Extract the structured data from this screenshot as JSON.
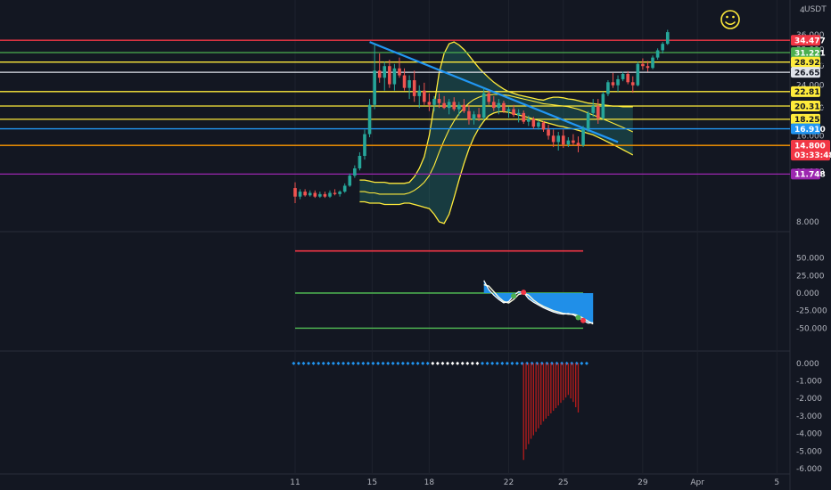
{
  "header": {
    "currency": "USDT",
    "corner_mark": "4"
  },
  "chart_data": [
    {
      "type": "candlestick",
      "panel": "price",
      "y_scale": "log",
      "ylim": [
        7.5,
        39
      ],
      "y_ticks": [
        "36.000",
        "32.000",
        "28.000",
        "24.000",
        "20.000",
        "16.000",
        "12.000",
        "8.000"
      ],
      "x_ticks": [
        "11",
        "15",
        "18",
        "22",
        "25",
        "29",
        "Apr",
        "5"
      ],
      "price_levels": [
        {
          "value": 34.477,
          "label": "34.477",
          "color": "#f23645"
        },
        {
          "value": 31.221,
          "label": "31.221",
          "color": "#4caf50"
        },
        {
          "value": 28.922,
          "label": "28.922",
          "color": "#ffeb3b"
        },
        {
          "value": 26.656,
          "label": "26.656",
          "color": "#e0e3eb"
        },
        {
          "value": 22.811,
          "label": "22.811",
          "color": "#ffeb3b"
        },
        {
          "value": 20.312,
          "label": "20.312",
          "color": "#ffeb3b"
        },
        {
          "value": 18.256,
          "label": "18.256",
          "color": "#ffeb3b"
        },
        {
          "value": 16.91,
          "label": "16.910",
          "color": "#2196f3"
        },
        {
          "value": 14.8,
          "label": "14.800",
          "color": "#ff9800"
        },
        {
          "value": 11.748,
          "label": "11.748",
          "color": "#9c27b0"
        }
      ],
      "current_price": {
        "label": "14.800",
        "countdown": "03:33:48",
        "color": "#f23645"
      },
      "candles": [
        [
          10.5,
          11.0,
          9.3,
          9.8
        ],
        [
          9.8,
          10.4,
          9.6,
          10.2
        ],
        [
          10.2,
          10.4,
          9.8,
          9.9
        ],
        [
          9.9,
          10.3,
          9.8,
          10.1
        ],
        [
          10.1,
          10.3,
          9.7,
          9.8
        ],
        [
          9.8,
          10.2,
          9.7,
          10.0
        ],
        [
          10.0,
          10.2,
          9.7,
          9.8
        ],
        [
          9.8,
          10.3,
          9.7,
          10.1
        ],
        [
          10.1,
          10.4,
          9.9,
          10.0
        ],
        [
          10.0,
          10.3,
          9.8,
          10.2
        ],
        [
          10.2,
          10.9,
          10.1,
          10.7
        ],
        [
          10.7,
          11.8,
          10.6,
          11.6
        ],
        [
          11.6,
          12.6,
          11.4,
          12.3
        ],
        [
          12.3,
          14.0,
          12.1,
          13.6
        ],
        [
          13.6,
          16.8,
          13.2,
          16.2
        ],
        [
          16.2,
          21.5,
          15.8,
          20.5
        ],
        [
          20.5,
          33.5,
          19.8,
          27.0
        ],
        [
          27.0,
          31.0,
          24.5,
          25.5
        ],
        [
          25.5,
          29.0,
          23.0,
          28.0
        ],
        [
          28.0,
          29.5,
          23.5,
          24.2
        ],
        [
          24.2,
          28.5,
          23.0,
          27.5
        ],
        [
          27.5,
          30.0,
          25.5,
          26.0
        ],
        [
          26.0,
          27.5,
          23.0,
          23.5
        ],
        [
          23.5,
          26.0,
          21.5,
          25.0
        ],
        [
          25.0,
          27.0,
          21.0,
          22.0
        ],
        [
          22.0,
          24.0,
          20.0,
          23.0
        ],
        [
          23.0,
          24.5,
          20.5,
          21.0
        ],
        [
          21.0,
          22.5,
          19.5,
          20.5
        ],
        [
          20.5,
          22.0,
          19.5,
          21.5
        ],
        [
          21.5,
          22.5,
          20.0,
          20.8
        ],
        [
          20.8,
          22.0,
          19.8,
          20.0
        ],
        [
          20.0,
          21.5,
          19.0,
          21.0
        ],
        [
          21.0,
          21.8,
          19.5,
          19.8
        ],
        [
          19.8,
          21.0,
          18.8,
          20.5
        ],
        [
          20.5,
          21.5,
          19.2,
          19.5
        ],
        [
          19.5,
          20.5,
          17.5,
          18.2
        ],
        [
          18.2,
          19.5,
          17.5,
          19.0
        ],
        [
          19.0,
          20.0,
          18.0,
          18.5
        ],
        [
          18.5,
          23.5,
          18.2,
          22.5
        ],
        [
          22.5,
          23.0,
          20.5,
          21.0
        ],
        [
          21.0,
          22.0,
          19.5,
          20.0
        ],
        [
          20.0,
          21.5,
          19.0,
          20.8
        ],
        [
          20.8,
          21.2,
          19.2,
          19.5
        ],
        [
          19.5,
          20.2,
          18.5,
          19.8
        ],
        [
          19.8,
          20.5,
          18.6,
          18.9
        ],
        [
          18.9,
          19.8,
          17.8,
          19.2
        ],
        [
          19.2,
          19.6,
          17.6,
          17.9
        ],
        [
          17.9,
          18.8,
          17.3,
          18.3
        ],
        [
          18.3,
          18.6,
          16.9,
          17.2
        ],
        [
          17.2,
          18.2,
          16.8,
          17.8
        ],
        [
          17.8,
          18.0,
          16.5,
          16.8
        ],
        [
          16.8,
          17.5,
          15.5,
          16.0
        ],
        [
          16.0,
          16.8,
          14.6,
          15.2
        ],
        [
          15.2,
          16.5,
          14.2,
          16.0
        ],
        [
          16.0,
          16.8,
          14.5,
          14.9
        ],
        [
          14.9,
          15.8,
          14.6,
          15.4
        ],
        [
          15.4,
          16.2,
          14.8,
          15.1
        ],
        [
          15.1,
          15.9,
          14.0,
          14.8
        ],
        [
          14.8,
          17.3,
          14.6,
          16.9
        ],
        [
          16.9,
          19.5,
          16.5,
          19.2
        ],
        [
          19.2,
          21.5,
          18.6,
          20.3
        ],
        [
          20.3,
          21.5,
          17.6,
          18.4
        ],
        [
          18.4,
          22.8,
          18.2,
          22.4
        ],
        [
          22.4,
          25.0,
          22.0,
          24.6
        ],
        [
          24.6,
          26.5,
          23.5,
          24.0
        ],
        [
          24.0,
          26.0,
          22.8,
          25.2
        ],
        [
          25.2,
          26.8,
          24.8,
          26.3
        ],
        [
          26.3,
          26.9,
          24.2,
          24.6
        ],
        [
          24.6,
          25.8,
          22.6,
          24.0
        ],
        [
          24.0,
          29.0,
          23.8,
          28.5
        ],
        [
          28.5,
          29.8,
          27.2,
          28.0
        ],
        [
          28.0,
          29.2,
          26.8,
          27.6
        ],
        [
          27.6,
          30.5,
          27.3,
          30.0
        ],
        [
          30.0,
          32.3,
          29.5,
          31.8
        ],
        [
          31.8,
          34.0,
          31.0,
          33.5
        ],
        [
          33.5,
          37.5,
          33.2,
          36.8
        ]
      ],
      "bollinger": {
        "upper": [
          11.2,
          11.2,
          11.1,
          11.0,
          11.0,
          11.0,
          10.9,
          10.9,
          10.9,
          10.9,
          11.0,
          11.5,
          12.3,
          13.5,
          16.0,
          20.5,
          26.5,
          31.0,
          33.5,
          34.0,
          33.2,
          32.0,
          30.5,
          29.0,
          27.6,
          26.5,
          25.5,
          24.6,
          23.9,
          23.3,
          22.8,
          22.5,
          22.2,
          22.0,
          21.8,
          21.6,
          21.4,
          21.3,
          21.6,
          21.8,
          21.8,
          21.7,
          21.5,
          21.4,
          21.2,
          21.0,
          20.8,
          20.7,
          20.6,
          20.5,
          20.4,
          20.3,
          20.3,
          20.2,
          20.2,
          20.2
        ],
        "middle": [
          10.2,
          10.2,
          10.1,
          10.1,
          10.0,
          10.0,
          10.0,
          10.0,
          10.0,
          10.0,
          10.1,
          10.3,
          10.6,
          11.0,
          11.6,
          12.6,
          14.0,
          15.4,
          16.8,
          18.0,
          19.1,
          20.0,
          20.8,
          21.4,
          21.8,
          22.1,
          22.2,
          22.3,
          22.3,
          22.2,
          22.1,
          21.9,
          21.7,
          21.5,
          21.3,
          21.1,
          20.9,
          20.7,
          20.6,
          20.5,
          20.4,
          20.3,
          20.2,
          20.0,
          19.8,
          19.5,
          19.2,
          18.9,
          18.6,
          18.3,
          18.0,
          17.7,
          17.4,
          17.1,
          16.8,
          16.5
        ],
        "lower": [
          9.4,
          9.4,
          9.3,
          9.3,
          9.3,
          9.2,
          9.2,
          9.2,
          9.2,
          9.3,
          9.3,
          9.2,
          9.1,
          9.0,
          8.9,
          8.5,
          8.0,
          7.9,
          8.5,
          9.7,
          11.2,
          12.8,
          14.4,
          15.8,
          17.0,
          18.0,
          18.8,
          19.2,
          19.4,
          19.4,
          19.3,
          19.1,
          18.9,
          18.7,
          18.5,
          18.3,
          18.1,
          17.9,
          17.7,
          17.5,
          17.3,
          17.2,
          17.0,
          16.9,
          16.7,
          16.5,
          16.3,
          16.1,
          15.8,
          15.5,
          15.2,
          14.9,
          14.6,
          14.3,
          14.0,
          13.7
        ]
      },
      "trendline": {
        "start": [
          15,
          34.0
        ],
        "end": [
          65,
          15.2
        ],
        "color": "#2196f3"
      }
    },
    {
      "type": "area",
      "panel": "oscillator",
      "ylim": [
        -80,
        85
      ],
      "y_ticks": [
        "50.000",
        "25.000",
        "0.000",
        "-25.000",
        "-50.000"
      ],
      "levels": [
        {
          "value": 60,
          "color": "#f23645"
        },
        {
          "value": 0,
          "color": "#4caf50"
        },
        {
          "value": -50,
          "color": "#4caf50"
        }
      ],
      "x": [
        38,
        39,
        40,
        41,
        42,
        43,
        44,
        45,
        46,
        47,
        48,
        49,
        50,
        51,
        52,
        53,
        54,
        55,
        56,
        57,
        58,
        59,
        60
      ],
      "values": [
        18,
        5,
        -3,
        -9,
        -14,
        -12,
        -4,
        2,
        1,
        -8,
        -13,
        -17,
        -21,
        -24,
        -27,
        -29,
        -30,
        -29,
        -31,
        -35,
        -39,
        -43,
        -42
      ],
      "signal": [
        12,
        10,
        2,
        -6,
        -12,
        -14,
        -9,
        -2,
        0,
        -3,
        -10,
        -15,
        -19,
        -22,
        -25,
        -27,
        -29,
        -30,
        -30,
        -32,
        -36,
        -40,
        -44
      ],
      "markers": [
        {
          "x": 44,
          "color": "#4caf50"
        },
        {
          "x": 46,
          "color": "#f23645"
        },
        {
          "x": 57,
          "color": "#4caf50"
        },
        {
          "x": 58,
          "color": "#f23645"
        }
      ]
    },
    {
      "type": "bar",
      "panel": "histogram",
      "ylim": [
        -6.2,
        0.6
      ],
      "y_ticks": [
        "0.000",
        "-1.000",
        "-2.000",
        "-3.000",
        "-4.000",
        "-5.000",
        "-6.000"
      ],
      "x_start": 46,
      "values": [
        -5.5,
        -4.9,
        -4.6,
        -4.3,
        -4.1,
        -3.9,
        -3.7,
        -3.5,
        -3.3,
        -3.15,
        -3.0,
        -2.85,
        -2.7,
        -2.55,
        -2.4,
        -2.25,
        -2.1,
        -1.95,
        -1.8,
        -2.0,
        -2.2,
        -2.5,
        -2.8
      ],
      "dots_count": 60
    }
  ]
}
